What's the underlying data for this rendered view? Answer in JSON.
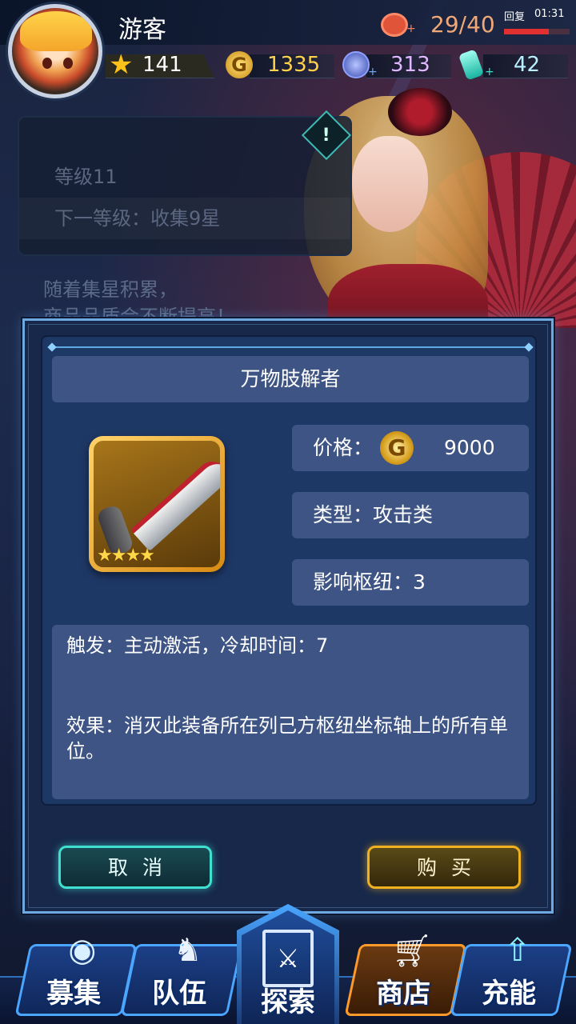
{
  "player": {
    "name": "游客",
    "stamina": "29/40",
    "recover_label": "回复",
    "recover_time": "01:31",
    "recover_progress": 0.68
  },
  "resources": {
    "stars": "141",
    "gold": "1335",
    "crystal": "313",
    "energy": "42"
  },
  "background_info": {
    "level": "等级11",
    "next_level": "下一等级：收集9星",
    "flavor": "随着集星积累，",
    "flavor_line2": "商品品质会不断提高！"
  },
  "dialog": {
    "title": "万物肢解者",
    "price_label": "价格：",
    "price": "9000",
    "type": "类型：攻击类",
    "influence": "影响枢纽：3",
    "item_stars": 4,
    "trigger": "触发：主动激活，冷却时间：7",
    "effect": "效果：消灭此装备所在列己方枢纽坐标轴上的所有单位。",
    "cancel_label": "取消",
    "buy_label": "购买"
  },
  "nav": {
    "recruit": "募集",
    "team": "队伍",
    "explore": "探索",
    "shop": "商店",
    "energy": "充能"
  },
  "colors": {
    "accent_cyan": "#3fe0d0",
    "accent_gold": "#f0b020",
    "panel": "#3d5484"
  }
}
